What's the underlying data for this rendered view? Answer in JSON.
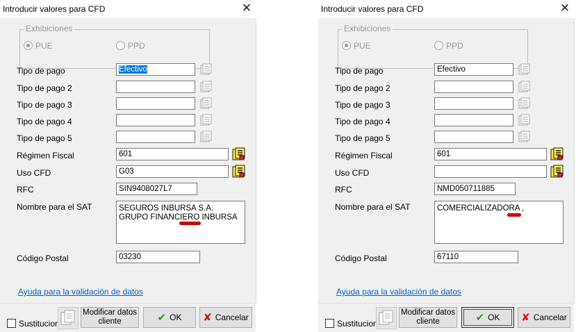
{
  "dialogs": [
    {
      "title": "Introducir valores para CFD",
      "group_label": "Exhibiciones",
      "radio_pue": "PUE",
      "radio_ppd": "PPD",
      "labels": {
        "tipo_pago": "Tipo de pago",
        "tipo_pago2": "Tipo de pago 2",
        "tipo_pago3": "Tipo de pago 3",
        "tipo_pago4": "Tipo de pago 4",
        "tipo_pago5": "Tipo de pago 5",
        "regimen": "Régimen Fiscal",
        "uso": "Uso CFD",
        "rfc": "RFC",
        "nombre": "Nombre para el SAT",
        "cp": "Código Postal"
      },
      "values": {
        "tipo_pago": "Efectivo",
        "tipo_pago2": "",
        "tipo_pago3": "",
        "tipo_pago4": "",
        "tipo_pago5": "",
        "regimen": "601",
        "uso": "G03",
        "rfc": "SIN9408027L7",
        "nombre": "SEGUROS INBURSA S.A. GRUPO FINANCIERO INBURSA",
        "cp": "03230"
      },
      "link": "Ayuda para la validación de datos",
      "checkbox_label": "Sustitucion",
      "btn_modificar": "Modificar datos cliente",
      "btn_ok": "OK",
      "btn_cancel": "Cancelar"
    },
    {
      "title": "Introducir valores para CFD",
      "group_label": "Exhibiciones",
      "radio_pue": "PUE",
      "radio_ppd": "PPD",
      "labels": {
        "tipo_pago": "Tipo de pago",
        "tipo_pago2": "Tipo de pago 2",
        "tipo_pago3": "Tipo de pago 3",
        "tipo_pago4": "Tipo de pago 4",
        "tipo_pago5": "Tipo de pago 5",
        "regimen": "Régimen Fiscal",
        "uso": "Uso CFD",
        "rfc": "RFC",
        "nombre": "Nombre para el SAT",
        "cp": "Código Postal"
      },
      "values": {
        "tipo_pago": "Efectivo",
        "tipo_pago2": "",
        "tipo_pago3": "",
        "tipo_pago4": "",
        "tipo_pago5": "",
        "regimen": "601",
        "uso": "",
        "rfc": "NMD050711885",
        "nombre": "COMERCIALIZADORA ,",
        "cp": "67110"
      },
      "link": "Ayuda para la validación de datos",
      "checkbox_label": "Sustitucion",
      "btn_modificar": "Modificar datos cliente",
      "btn_ok": "OK",
      "btn_cancel": "Cancelar"
    }
  ],
  "colors": {
    "link": "#0563c1",
    "selection": "#0078d7",
    "underline_mark": "#cc0000",
    "ok_icon": "#1f9a1f",
    "cancel_icon": "#d31414"
  },
  "icons": {
    "picker": "list-picker-icon",
    "picker_active": "edit-list-icon",
    "ok": "check-icon",
    "cancel": "cancel-x-icon",
    "substitute": "document-icon"
  }
}
